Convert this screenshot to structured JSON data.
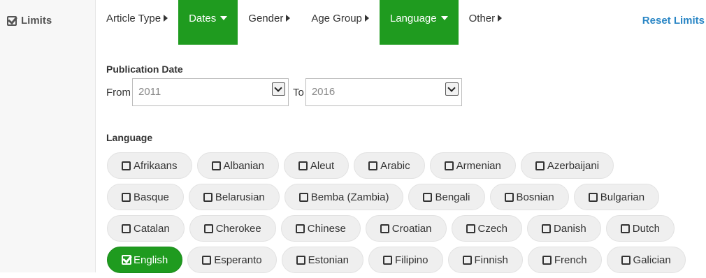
{
  "sidebar": {
    "label": "Limits"
  },
  "tabs": [
    {
      "label": "Article Type",
      "active": false,
      "caret": "right"
    },
    {
      "label": "Dates",
      "active": true,
      "caret": "down"
    },
    {
      "label": "Gender",
      "active": false,
      "caret": "right"
    },
    {
      "label": "Age Group",
      "active": false,
      "caret": "right"
    },
    {
      "label": "Language",
      "active": true,
      "caret": "down"
    },
    {
      "label": "Other",
      "active": false,
      "caret": "right"
    }
  ],
  "reset_label": "Reset Limits",
  "publication_date": {
    "title": "Publication Date",
    "from_label": "From",
    "from_value": "2011",
    "to_label": "To",
    "to_value": "2016"
  },
  "language": {
    "title": "Language",
    "rows": [
      [
        {
          "label": "Afrikaans",
          "checked": false
        },
        {
          "label": "Albanian",
          "checked": false
        },
        {
          "label": "Aleut",
          "checked": false
        },
        {
          "label": "Arabic",
          "checked": false
        },
        {
          "label": "Armenian",
          "checked": false
        },
        {
          "label": "Azerbaijani",
          "checked": false
        }
      ],
      [
        {
          "label": "Basque",
          "checked": false
        },
        {
          "label": "Belarusian",
          "checked": false
        },
        {
          "label": "Bemba (Zambia)",
          "checked": false
        },
        {
          "label": "Bengali",
          "checked": false
        },
        {
          "label": "Bosnian",
          "checked": false
        },
        {
          "label": "Bulgarian",
          "checked": false
        }
      ],
      [
        {
          "label": "Catalan",
          "checked": false
        },
        {
          "label": "Cherokee",
          "checked": false
        },
        {
          "label": "Chinese",
          "checked": false
        },
        {
          "label": "Croatian",
          "checked": false
        },
        {
          "label": "Czech",
          "checked": false
        },
        {
          "label": "Danish",
          "checked": false
        },
        {
          "label": "Dutch",
          "checked": false
        }
      ],
      [
        {
          "label": "English",
          "checked": true
        },
        {
          "label": "Esperanto",
          "checked": false
        },
        {
          "label": "Estonian",
          "checked": false
        },
        {
          "label": "Filipino",
          "checked": false
        },
        {
          "label": "Finnish",
          "checked": false
        },
        {
          "label": "French",
          "checked": false
        },
        {
          "label": "Galician",
          "checked": false
        }
      ]
    ]
  },
  "colors": {
    "accent_green": "#1f9b1f",
    "link_blue": "#2a86c5"
  }
}
